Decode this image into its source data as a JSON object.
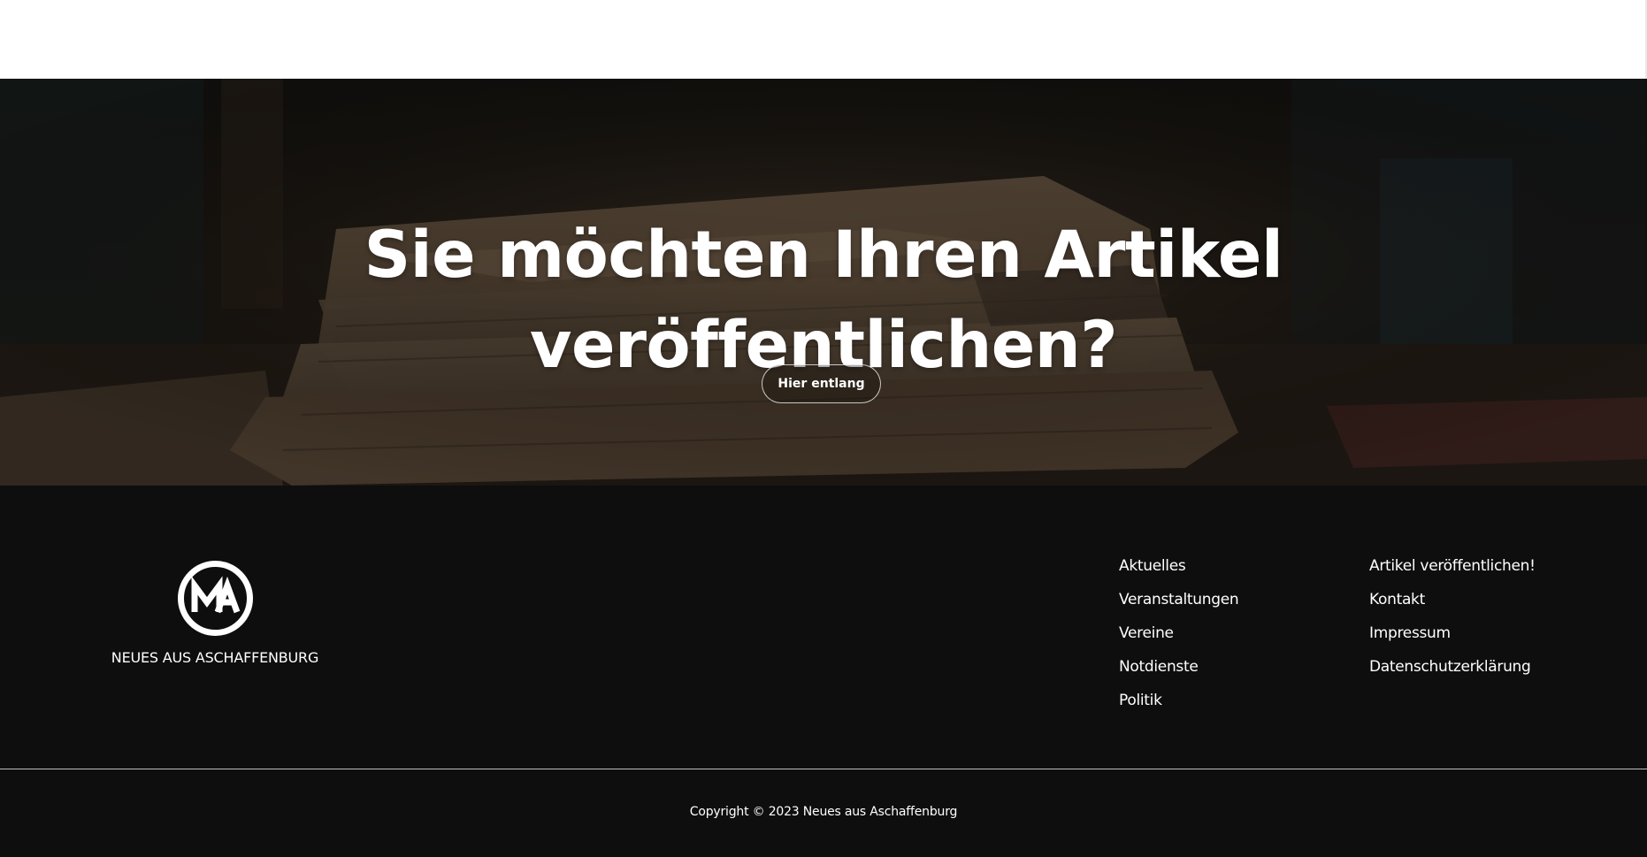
{
  "hero": {
    "title_line1": "Sie möchten Ihren Artikel",
    "title_line2": "veröffentlichen?",
    "button_label": "Hier entlang"
  },
  "footer": {
    "brand_name": "NEUES AUS ASCHAFFENBURG",
    "column1": [
      {
        "label": "Aktuelles"
      },
      {
        "label": "Veranstaltungen"
      },
      {
        "label": "Vereine"
      },
      {
        "label": "Notdienste"
      },
      {
        "label": "Politik"
      }
    ],
    "column2": [
      {
        "label": "Artikel veröffentlichen!"
      },
      {
        "label": "Kontakt"
      },
      {
        "label": "Impressum"
      },
      {
        "label": "Datenschutzerklärung"
      }
    ],
    "copyright": "Copyright © 2023 Neues aus Aschaffenburg"
  },
  "colors": {
    "footer_bg": "#0e0e0e",
    "text": "#ffffff",
    "top_strip": "#ffffff"
  },
  "icons": {
    "logo": "na-monogram-circle-icon"
  }
}
